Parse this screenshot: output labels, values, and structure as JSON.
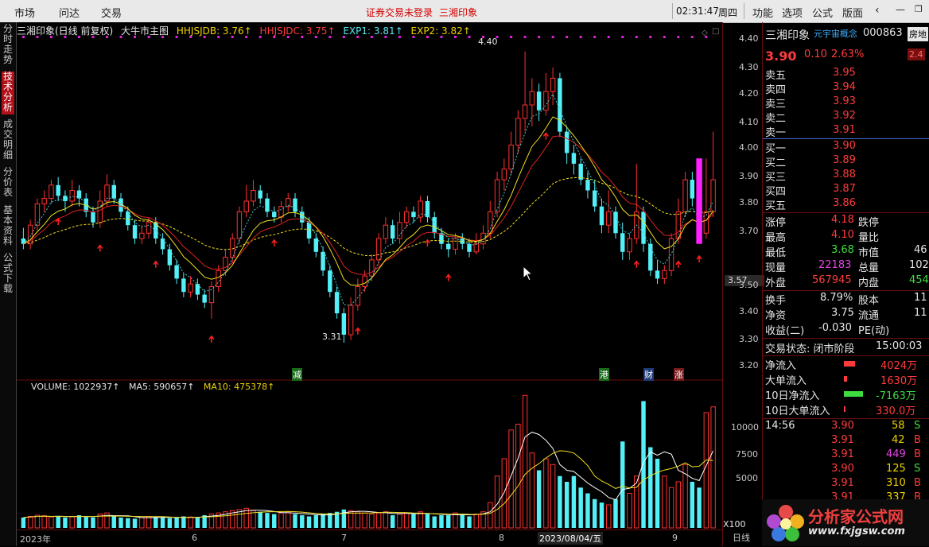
{
  "menubar": {
    "items": [
      "市场",
      "问达",
      "交易"
    ],
    "notice": "证券交易未登录",
    "notice_stock": "三湘印象",
    "clock": "02:31:47",
    "weekday": "周四",
    "right_items": [
      "功能",
      "选项",
      "公式",
      "版面"
    ]
  },
  "sidetabs": [
    {
      "label": "分时走势",
      "active": false
    },
    {
      "label": "技术分析",
      "active": true
    },
    {
      "label": "成交明细",
      "active": false
    },
    {
      "label": "分价表",
      "active": false
    },
    {
      "label": "基本资料",
      "active": false
    },
    {
      "label": "公式下载",
      "active": false
    }
  ],
  "chart_header": {
    "stock": "三湘印象(日线 前复权)",
    "indicator": "大牛市主图",
    "hhjsjdb": "HHJSJDB: 3.76↑",
    "hhjsjdc": "HHJSJDC: 3.75↑",
    "exp1": "EXP1: 3.81↑",
    "exp2": "EXP2: 3.82↑"
  },
  "volume_header": {
    "volume": "VOLUME: 1022937↑",
    "ma5": "MA5: 590657↑",
    "ma10": "MA10: 475378↑"
  },
  "annotations": {
    "high": "4.40",
    "low": "3.31",
    "marks": [
      "减",
      "港",
      "财",
      "涨"
    ],
    "cursor_price": "3.57",
    "date_cursor": "2023/08/04/五",
    "x100": "X100",
    "period": "日线"
  },
  "price_axis": [
    "4.40",
    "4.30",
    "4.20",
    "4.10",
    "4.00",
    "3.90",
    "3.80",
    "3.70",
    "3.60",
    "3.50",
    "3.40",
    "3.30",
    "3.20"
  ],
  "volume_axis": [
    "10000",
    "7500",
    "5000"
  ],
  "date_axis": [
    "2023年",
    "6",
    "7",
    "8",
    "9"
  ],
  "quote": {
    "name": "三湘印象",
    "concept": "元宇宙概念",
    "code": "000863",
    "tag": "房地",
    "tag_value": "2.4",
    "price": "3.90",
    "change": "0.10",
    "pct": "2.63%",
    "asks": [
      {
        "label": "卖五",
        "price": "3.95"
      },
      {
        "label": "卖四",
        "price": "3.94"
      },
      {
        "label": "卖三",
        "price": "3.93"
      },
      {
        "label": "卖二",
        "price": "3.92"
      },
      {
        "label": "卖一",
        "price": "3.91"
      }
    ],
    "bids": [
      {
        "label": "买一",
        "price": "3.90"
      },
      {
        "label": "买二",
        "price": "3.89"
      },
      {
        "label": "买三",
        "price": "3.88"
      },
      {
        "label": "买四",
        "price": "3.87"
      },
      {
        "label": "买五",
        "price": "3.86"
      }
    ],
    "stats": [
      {
        "l1": "涨停",
        "v1": "4.18",
        "l2": "跌停",
        "v2": ""
      },
      {
        "l1": "最高",
        "v1": "4.10",
        "l2": "量比",
        "v2": ""
      },
      {
        "l1": "最低",
        "v1": "3.68",
        "l2": "市值",
        "v2": "46"
      },
      {
        "l1": "现量",
        "v1": "22183",
        "l2": "总量",
        "v2": "102"
      },
      {
        "l1": "外盘",
        "v1": "567945",
        "l2": "内盘",
        "v2": "454"
      }
    ],
    "stats2": [
      {
        "l1": "换手",
        "v1": "8.79%",
        "l2": "股本",
        "v2": "11"
      },
      {
        "l1": "净资",
        "v1": "3.75",
        "l2": "流通",
        "v2": "11"
      },
      {
        "l1": "收益(二)",
        "v1": "-0.030",
        "l2": "PE(动)",
        "v2": ""
      }
    ],
    "trade_state": "交易状态: 闭市阶段",
    "trade_time": "15:00:03",
    "flows": [
      {
        "label": "净流入",
        "value": "4024万",
        "bar": "red"
      },
      {
        "label": "大单流入",
        "value": "1630万",
        "bar": "red"
      },
      {
        "label": "10日净流入",
        "value": "-7163万",
        "bar": "green"
      },
      {
        "label": "10日大单流入",
        "value": "330.0万",
        "bar": "red"
      }
    ],
    "ticks": [
      {
        "time": "14:56",
        "price": "3.90",
        "vol": "58",
        "side": "S"
      },
      {
        "time": "",
        "price": "3.91",
        "vol": "42",
        "side": "B"
      },
      {
        "time": "",
        "price": "3.91",
        "vol": "449",
        "side": "B"
      },
      {
        "time": "",
        "price": "3.90",
        "vol": "125",
        "side": "S"
      },
      {
        "time": "",
        "price": "3.91",
        "vol": "310",
        "side": "B"
      },
      {
        "time": "",
        "price": "3.91",
        "vol": "337",
        "side": "B"
      }
    ]
  },
  "watermark": {
    "text": "分析家公式网",
    "url": "www.fxjgsw.com"
  },
  "chart_data": {
    "type": "candlestick",
    "ylim": [
      3.2,
      4.45
    ],
    "candles": [
      [
        3.7,
        3.68,
        3.74,
        3.66
      ],
      [
        3.68,
        3.75,
        3.77,
        3.66
      ],
      [
        3.75,
        3.83,
        3.85,
        3.73
      ],
      [
        3.83,
        3.85,
        3.88,
        3.8
      ],
      [
        3.85,
        3.9,
        3.92,
        3.83
      ],
      [
        3.9,
        3.86,
        3.93,
        3.84
      ],
      [
        3.86,
        3.84,
        3.88,
        3.8
      ],
      [
        3.84,
        3.88,
        3.92,
        3.82
      ],
      [
        3.88,
        3.85,
        3.9,
        3.82
      ],
      [
        3.85,
        3.8,
        3.87,
        3.78
      ],
      [
        3.8,
        3.76,
        3.82,
        3.74
      ],
      [
        3.76,
        3.84,
        3.88,
        3.74
      ],
      [
        3.84,
        3.9,
        3.94,
        3.82
      ],
      [
        3.9,
        3.85,
        3.92,
        3.83
      ],
      [
        3.85,
        3.8,
        3.87,
        3.78
      ],
      [
        3.8,
        3.75,
        3.82,
        3.73
      ],
      [
        3.75,
        3.7,
        3.77,
        3.68
      ],
      [
        3.7,
        3.72,
        3.75,
        3.68
      ],
      [
        3.72,
        3.76,
        3.78,
        3.7
      ],
      [
        3.76,
        3.7,
        3.78,
        3.68
      ],
      [
        3.7,
        3.66,
        3.72,
        3.64
      ],
      [
        3.66,
        3.6,
        3.68,
        3.58
      ],
      [
        3.6,
        3.55,
        3.62,
        3.53
      ],
      [
        3.55,
        3.5,
        3.57,
        3.48
      ],
      [
        3.5,
        3.53,
        3.56,
        3.48
      ],
      [
        3.53,
        3.49,
        3.55,
        3.47
      ],
      [
        3.49,
        3.46,
        3.51,
        3.44
      ],
      [
        3.46,
        3.52,
        3.54,
        3.4
      ],
      [
        3.52,
        3.58,
        3.6,
        3.5
      ],
      [
        3.58,
        3.63,
        3.66,
        3.56
      ],
      [
        3.63,
        3.7,
        3.72,
        3.61
      ],
      [
        3.7,
        3.8,
        3.82,
        3.68
      ],
      [
        3.8,
        3.84,
        3.9,
        3.78
      ],
      [
        3.84,
        3.88,
        3.92,
        3.82
      ],
      [
        3.88,
        3.85,
        3.9,
        3.83
      ],
      [
        3.85,
        3.8,
        3.87,
        3.78
      ],
      [
        3.8,
        3.78,
        3.82,
        3.76
      ],
      [
        3.78,
        3.82,
        3.84,
        3.76
      ],
      [
        3.82,
        3.85,
        3.87,
        3.8
      ],
      [
        3.85,
        3.8,
        3.87,
        3.78
      ],
      [
        3.8,
        3.76,
        3.82,
        3.74
      ],
      [
        3.76,
        3.7,
        3.78,
        3.68
      ],
      [
        3.7,
        3.65,
        3.72,
        3.63
      ],
      [
        3.65,
        3.58,
        3.67,
        3.56
      ],
      [
        3.58,
        3.5,
        3.6,
        3.48
      ],
      [
        3.5,
        3.42,
        3.52,
        3.4
      ],
      [
        3.42,
        3.34,
        3.44,
        3.31
      ],
      [
        3.34,
        3.45,
        3.48,
        3.32
      ],
      [
        3.45,
        3.52,
        3.55,
        3.43
      ],
      [
        3.52,
        3.56,
        3.58,
        3.5
      ],
      [
        3.56,
        3.62,
        3.64,
        3.54
      ],
      [
        3.62,
        3.7,
        3.72,
        3.6
      ],
      [
        3.7,
        3.75,
        3.78,
        3.68
      ],
      [
        3.75,
        3.7,
        3.77,
        3.68
      ],
      [
        3.7,
        3.76,
        3.8,
        3.68
      ],
      [
        3.76,
        3.8,
        3.82,
        3.74
      ],
      [
        3.8,
        3.78,
        3.82,
        3.76
      ],
      [
        3.78,
        3.84,
        3.86,
        3.76
      ],
      [
        3.84,
        3.78,
        3.86,
        3.76
      ],
      [
        3.78,
        3.72,
        3.8,
        3.7
      ],
      [
        3.72,
        3.68,
        3.74,
        3.66
      ],
      [
        3.68,
        3.66,
        3.7,
        3.63
      ],
      [
        3.66,
        3.7,
        3.72,
        3.64
      ],
      [
        3.7,
        3.68,
        3.72,
        3.66
      ],
      [
        3.68,
        3.65,
        3.7,
        3.63
      ],
      [
        3.65,
        3.68,
        3.72,
        3.64
      ],
      [
        3.68,
        3.72,
        3.75,
        3.66
      ],
      [
        3.72,
        3.8,
        3.84,
        3.7
      ],
      [
        3.8,
        3.92,
        3.95,
        3.78
      ],
      [
        3.92,
        3.96,
        4.0,
        3.88
      ],
      [
        3.96,
        4.05,
        4.1,
        3.94
      ],
      [
        4.05,
        4.15,
        4.18,
        4.02
      ],
      [
        4.15,
        4.2,
        4.4,
        4.1
      ],
      [
        4.2,
        4.25,
        4.3,
        4.12
      ],
      [
        4.25,
        4.18,
        4.28,
        4.14
      ],
      [
        4.18,
        4.25,
        4.32,
        4.16
      ],
      [
        4.25,
        4.3,
        4.34,
        4.2
      ],
      [
        4.3,
        4.1,
        4.32,
        4.08
      ],
      [
        4.1,
        4.02,
        4.12,
        3.98
      ],
      [
        4.02,
        3.98,
        4.05,
        3.94
      ],
      [
        3.98,
        3.92,
        4.0,
        3.9
      ],
      [
        3.92,
        3.88,
        3.95,
        3.85
      ],
      [
        3.88,
        3.82,
        3.92,
        3.8
      ],
      [
        3.82,
        3.75,
        3.85,
        3.72
      ],
      [
        3.75,
        3.8,
        3.88,
        3.72
      ],
      [
        3.8,
        3.72,
        3.82,
        3.7
      ],
      [
        3.72,
        3.65,
        3.76,
        3.62
      ],
      [
        3.65,
        3.7,
        3.72,
        3.62
      ],
      [
        3.7,
        3.8,
        3.98,
        3.68
      ],
      [
        3.8,
        3.68,
        3.82,
        3.65
      ],
      [
        3.68,
        3.58,
        3.7,
        3.56
      ],
      [
        3.58,
        3.55,
        3.62,
        3.53
      ],
      [
        3.55,
        3.58,
        3.6,
        3.53
      ],
      [
        3.58,
        3.7,
        3.72,
        3.56
      ],
      [
        3.7,
        3.8,
        3.85,
        3.68
      ],
      [
        3.8,
        3.92,
        3.95,
        3.78
      ],
      [
        3.92,
        3.85,
        3.95,
        3.82
      ],
      [
        3.85,
        3.72,
        3.88,
        3.7
      ],
      [
        3.72,
        3.8,
        4.0,
        3.7
      ],
      [
        3.8,
        3.92,
        4.1,
        3.78
      ]
    ],
    "volume": [
      900,
      1000,
      1100,
      1050,
      950,
      1000,
      900,
      1000,
      1100,
      950,
      900,
      1200,
      1300,
      1000,
      900,
      850,
      800,
      900,
      1000,
      950,
      900,
      850,
      900,
      1000,
      950,
      900,
      1100,
      1200,
      1300,
      1400,
      1500,
      1600,
      1700,
      1500,
      1400,
      1300,
      1200,
      1300,
      1400,
      1200,
      1100,
      1000,
      1100,
      1200,
      1300,
      1400,
      1600,
      1500,
      1400,
      1300,
      1200,
      1300,
      1400,
      1100,
      1200,
      1300,
      1200,
      1400,
      1200,
      1000,
      1100,
      1100,
      1300,
      1200,
      1000,
      1200,
      1400,
      2200,
      4500,
      6000,
      8500,
      9000,
      11500,
      6500,
      5000,
      6000,
      5500,
      4500,
      4000,
      4500,
      3500,
      3000,
      2500,
      2200,
      2000,
      2500,
      7500,
      3000,
      4500,
      11000,
      7000,
      6000,
      4500,
      3500,
      4000,
      5500,
      4000,
      3500,
      10000,
      10500
    ]
  }
}
